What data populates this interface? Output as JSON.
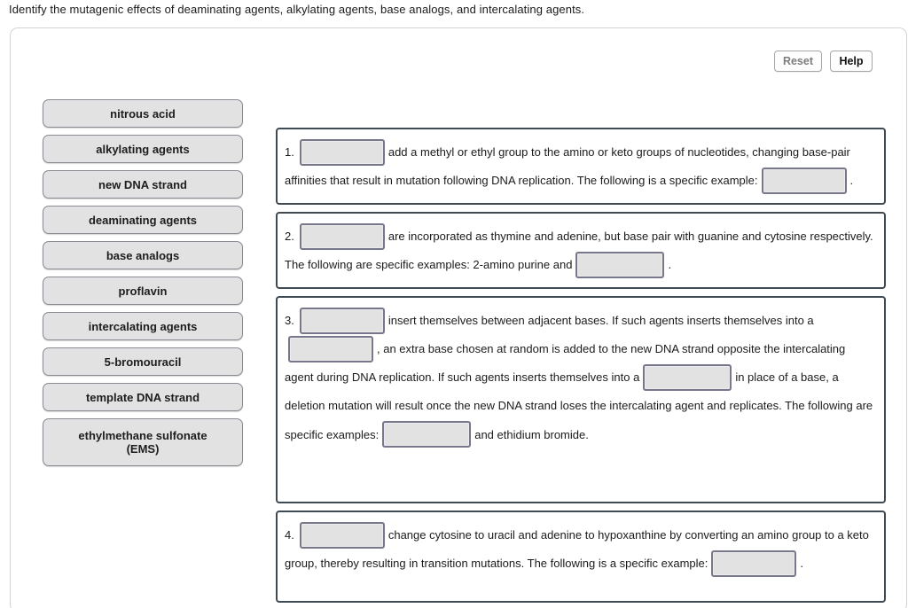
{
  "prompt": "Identify the mutagenic effects of deaminating agents, alkylating agents, base analogs, and intercalating agents.",
  "toolbar": {
    "reset_label": "Reset",
    "help_label": "Help"
  },
  "bank": {
    "items": [
      {
        "label": "nitrous acid"
      },
      {
        "label": "alkylating agents"
      },
      {
        "label": "new DNA strand"
      },
      {
        "label": "deaminating agents"
      },
      {
        "label": "base analogs"
      },
      {
        "label": "proflavin"
      },
      {
        "label": "intercalating agents"
      },
      {
        "label": "5-bromouracil"
      },
      {
        "label": "template DNA strand"
      },
      {
        "label": "ethylmethane sulfonate\n(EMS)"
      }
    ]
  },
  "panels": [
    {
      "number": "1.",
      "seg1": "add a methyl or ethyl group to the amino or keto groups of nucleotides, changing base-pair affinities that result in mutation following DNA replication. The following is a specific example:",
      "seg2": "."
    },
    {
      "number": "2.",
      "seg1": "are incorporated as thymine and adenine, but base pair with guanine and cytosine respectively. The following are specific examples: 2-amino purine and",
      "seg2": "."
    },
    {
      "number": "3.",
      "seg1": "insert themselves between adjacent bases. If such agents inserts themselves into a",
      "seg2": ", an extra base chosen at random is added to the new DNA strand opposite the intercalating agent during DNA replication. If such agents inserts themselves into a",
      "seg3": "in place of a base, a deletion mutation will result once the new DNA strand loses the intercalating agent and replicates. The following are specific examples:",
      "seg4": "and ethidium bromide."
    },
    {
      "number": "4.",
      "seg1": "change cytosine to uracil and adenine to hypoxanthine by converting an amino group to a keto group, thereby resulting in transition mutations. The following is a specific example:",
      "seg2": "."
    }
  ]
}
